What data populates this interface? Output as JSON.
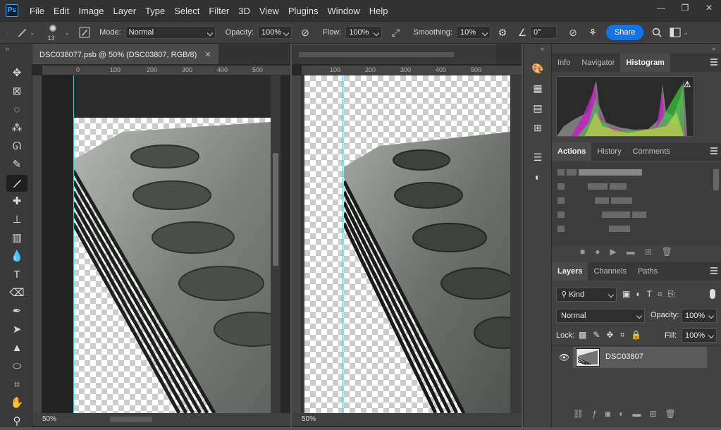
{
  "app": {
    "logo_text": "Ps"
  },
  "menu": [
    "File",
    "Edit",
    "Image",
    "Layer",
    "Type",
    "Select",
    "Filter",
    "3D",
    "View",
    "Plugins",
    "Window",
    "Help"
  ],
  "window_controls": {
    "minimize": "—",
    "restore": "❐",
    "close": "✕"
  },
  "options": {
    "brush_size": "13",
    "mode_label": "Mode:",
    "mode_value": "Normal",
    "opacity_label": "Opacity:",
    "opacity_value": "100%",
    "flow_label": "Flow:",
    "flow_value": "100%",
    "smoothing_label": "Smoothing:",
    "smoothing_value": "10%",
    "angle_value": "0°",
    "share_label": "Share"
  },
  "documents": [
    {
      "title": "DSC038077.psb @ 50% (DSC03807, RGB/8)",
      "zoom": "50%",
      "ruler_h": [
        "0",
        "100",
        "200",
        "300",
        "400",
        "500"
      ]
    },
    {
      "title": "",
      "zoom": "50%",
      "ruler_h": [
        "100",
        "200",
        "300",
        "400",
        "500"
      ]
    }
  ],
  "panels": {
    "top_tabs": [
      "Info",
      "Navigator",
      "Histogram"
    ],
    "mid_tabs": [
      "Actions",
      "History",
      "Comments"
    ],
    "layers_tabs": [
      "Layers",
      "Channels",
      "Paths"
    ],
    "layers": {
      "filter_kind": "Kind",
      "blend_mode": "Normal",
      "opacity_label": "Opacity:",
      "opacity_value": "100%",
      "lock_label": "Lock:",
      "fill_label": "Fill:",
      "fill_value": "100%",
      "layer_name": "DSC03807"
    }
  },
  "colors": {
    "accent": "#1473e6",
    "guide": "#3ad0d8"
  }
}
